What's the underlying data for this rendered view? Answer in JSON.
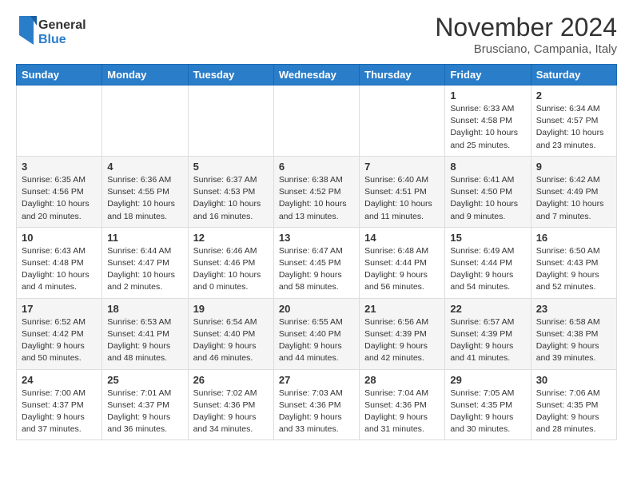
{
  "header": {
    "logo_general": "General",
    "logo_blue": "Blue",
    "month_title": "November 2024",
    "location": "Brusciano, Campania, Italy"
  },
  "weekdays": [
    "Sunday",
    "Monday",
    "Tuesday",
    "Wednesday",
    "Thursday",
    "Friday",
    "Saturday"
  ],
  "weeks": [
    [
      {
        "day": "",
        "info": ""
      },
      {
        "day": "",
        "info": ""
      },
      {
        "day": "",
        "info": ""
      },
      {
        "day": "",
        "info": ""
      },
      {
        "day": "",
        "info": ""
      },
      {
        "day": "1",
        "info": "Sunrise: 6:33 AM\nSunset: 4:58 PM\nDaylight: 10 hours and 25 minutes."
      },
      {
        "day": "2",
        "info": "Sunrise: 6:34 AM\nSunset: 4:57 PM\nDaylight: 10 hours and 23 minutes."
      }
    ],
    [
      {
        "day": "3",
        "info": "Sunrise: 6:35 AM\nSunset: 4:56 PM\nDaylight: 10 hours and 20 minutes."
      },
      {
        "day": "4",
        "info": "Sunrise: 6:36 AM\nSunset: 4:55 PM\nDaylight: 10 hours and 18 minutes."
      },
      {
        "day": "5",
        "info": "Sunrise: 6:37 AM\nSunset: 4:53 PM\nDaylight: 10 hours and 16 minutes."
      },
      {
        "day": "6",
        "info": "Sunrise: 6:38 AM\nSunset: 4:52 PM\nDaylight: 10 hours and 13 minutes."
      },
      {
        "day": "7",
        "info": "Sunrise: 6:40 AM\nSunset: 4:51 PM\nDaylight: 10 hours and 11 minutes."
      },
      {
        "day": "8",
        "info": "Sunrise: 6:41 AM\nSunset: 4:50 PM\nDaylight: 10 hours and 9 minutes."
      },
      {
        "day": "9",
        "info": "Sunrise: 6:42 AM\nSunset: 4:49 PM\nDaylight: 10 hours and 7 minutes."
      }
    ],
    [
      {
        "day": "10",
        "info": "Sunrise: 6:43 AM\nSunset: 4:48 PM\nDaylight: 10 hours and 4 minutes."
      },
      {
        "day": "11",
        "info": "Sunrise: 6:44 AM\nSunset: 4:47 PM\nDaylight: 10 hours and 2 minutes."
      },
      {
        "day": "12",
        "info": "Sunrise: 6:46 AM\nSunset: 4:46 PM\nDaylight: 10 hours and 0 minutes."
      },
      {
        "day": "13",
        "info": "Sunrise: 6:47 AM\nSunset: 4:45 PM\nDaylight: 9 hours and 58 minutes."
      },
      {
        "day": "14",
        "info": "Sunrise: 6:48 AM\nSunset: 4:44 PM\nDaylight: 9 hours and 56 minutes."
      },
      {
        "day": "15",
        "info": "Sunrise: 6:49 AM\nSunset: 4:44 PM\nDaylight: 9 hours and 54 minutes."
      },
      {
        "day": "16",
        "info": "Sunrise: 6:50 AM\nSunset: 4:43 PM\nDaylight: 9 hours and 52 minutes."
      }
    ],
    [
      {
        "day": "17",
        "info": "Sunrise: 6:52 AM\nSunset: 4:42 PM\nDaylight: 9 hours and 50 minutes."
      },
      {
        "day": "18",
        "info": "Sunrise: 6:53 AM\nSunset: 4:41 PM\nDaylight: 9 hours and 48 minutes."
      },
      {
        "day": "19",
        "info": "Sunrise: 6:54 AM\nSunset: 4:40 PM\nDaylight: 9 hours and 46 minutes."
      },
      {
        "day": "20",
        "info": "Sunrise: 6:55 AM\nSunset: 4:40 PM\nDaylight: 9 hours and 44 minutes."
      },
      {
        "day": "21",
        "info": "Sunrise: 6:56 AM\nSunset: 4:39 PM\nDaylight: 9 hours and 42 minutes."
      },
      {
        "day": "22",
        "info": "Sunrise: 6:57 AM\nSunset: 4:39 PM\nDaylight: 9 hours and 41 minutes."
      },
      {
        "day": "23",
        "info": "Sunrise: 6:58 AM\nSunset: 4:38 PM\nDaylight: 9 hours and 39 minutes."
      }
    ],
    [
      {
        "day": "24",
        "info": "Sunrise: 7:00 AM\nSunset: 4:37 PM\nDaylight: 9 hours and 37 minutes."
      },
      {
        "day": "25",
        "info": "Sunrise: 7:01 AM\nSunset: 4:37 PM\nDaylight: 9 hours and 36 minutes."
      },
      {
        "day": "26",
        "info": "Sunrise: 7:02 AM\nSunset: 4:36 PM\nDaylight: 9 hours and 34 minutes."
      },
      {
        "day": "27",
        "info": "Sunrise: 7:03 AM\nSunset: 4:36 PM\nDaylight: 9 hours and 33 minutes."
      },
      {
        "day": "28",
        "info": "Sunrise: 7:04 AM\nSunset: 4:36 PM\nDaylight: 9 hours and 31 minutes."
      },
      {
        "day": "29",
        "info": "Sunrise: 7:05 AM\nSunset: 4:35 PM\nDaylight: 9 hours and 30 minutes."
      },
      {
        "day": "30",
        "info": "Sunrise: 7:06 AM\nSunset: 4:35 PM\nDaylight: 9 hours and 28 minutes."
      }
    ]
  ]
}
